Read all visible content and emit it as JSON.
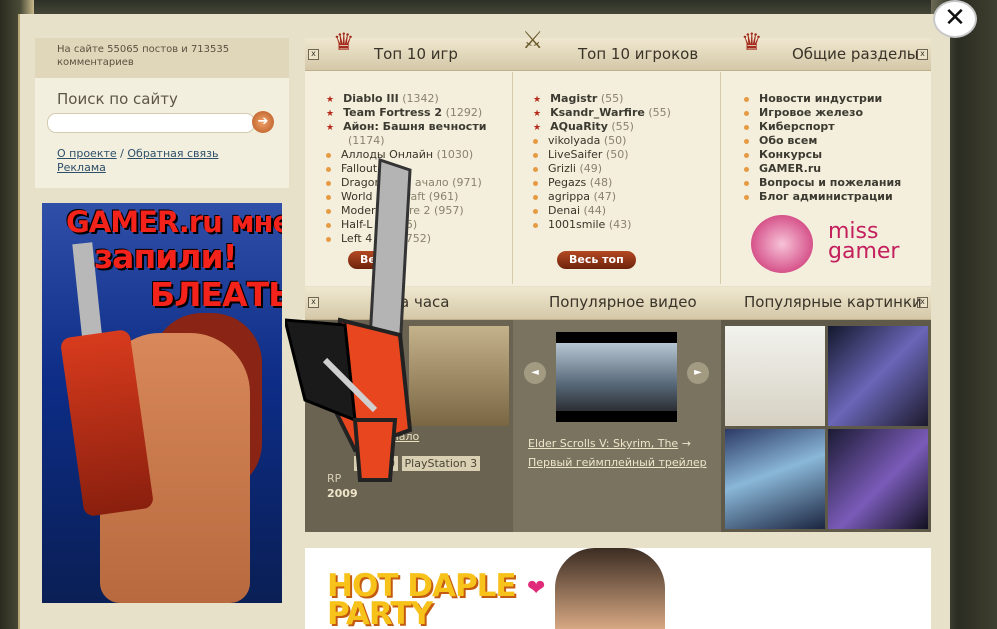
{
  "sidebar": {
    "stats": "На сайте 55065 постов и 713535 комментариев",
    "search_title": "Поиск по сайту",
    "search_placeholder": "",
    "about_link": "О проекте",
    "sep": "/",
    "feedback_link": "Обратная связь",
    "ads_link": "Реклама"
  },
  "ad": {
    "line1": "GAMER.ru мне",
    "line2": "запили!",
    "line3": "БЛЕАТЬ"
  },
  "top_games": {
    "title": "Топ 10 игр",
    "button": "Ве",
    "items": [
      {
        "name": "Diablo III",
        "count": "(1342)"
      },
      {
        "name": "Team Fortress 2",
        "count": "(1292)"
      },
      {
        "name": "Айон: Башня вечности",
        "count": "(1174)"
      },
      {
        "name": "Аллоды Онлайн",
        "count": "(1030)"
      },
      {
        "name": "Fallout",
        "count": ""
      },
      {
        "name": "Dragon",
        "count": "ачало (971)"
      },
      {
        "name": "World",
        "count": "raft (961)"
      },
      {
        "name": "Moder",
        "count": "re 2 (957)"
      },
      {
        "name": "Half-L",
        "count": "5)"
      },
      {
        "name": "Left 4",
        "count": "752)"
      }
    ]
  },
  "top_players": {
    "title": "Топ 10 игроков",
    "button": "Весь топ",
    "items": [
      {
        "name": "Magistr",
        "count": "(55)"
      },
      {
        "name": "Ksandr_Warfire",
        "count": "(55)"
      },
      {
        "name": "AQuaRity",
        "count": "(55)"
      },
      {
        "name": "vikolyada",
        "count": "(50)"
      },
      {
        "name": "LiveSaifer",
        "count": "(50)"
      },
      {
        "name": "Grizli",
        "count": "(49)"
      },
      {
        "name": "Pegazs",
        "count": "(48)"
      },
      {
        "name": "agrippa",
        "count": "(47)"
      },
      {
        "name": "Denai",
        "count": "(44)"
      },
      {
        "name": "1001smile",
        "count": "(43)"
      }
    ]
  },
  "sections": {
    "title": "Общие разделы",
    "items": [
      "Новости индустрии",
      "Игровое железо",
      "Киберспорт",
      "Обо всем",
      "Конкурсы",
      "GAMER.ru",
      "Вопросы и пожелания",
      "Блог администрации"
    ],
    "logo_text": "miss gamer"
  },
  "hour_game": {
    "title": "а часа",
    "name_link": ": Начало",
    "platforms": [
      "X",
      "360",
      "PlayStation 3"
    ],
    "genre": "RP",
    "year": "2009"
  },
  "video": {
    "title": "Популярное видео",
    "caption_link": "Elder Scrolls V: Skyrim, The",
    "caption_arrow": "→",
    "caption_sub": "Первый геймплейный трейлер",
    "prev": "◄",
    "next": "►"
  },
  "pictures": {
    "title": "Популярные картинки"
  },
  "footer_ad": {
    "line1": "HOT DAPLE",
    "line2": "PARTY"
  },
  "close": "✕",
  "colors": {
    "accent": "#b44a23",
    "parchment": "#e8e1c9",
    "link": "#2d4f6a"
  }
}
